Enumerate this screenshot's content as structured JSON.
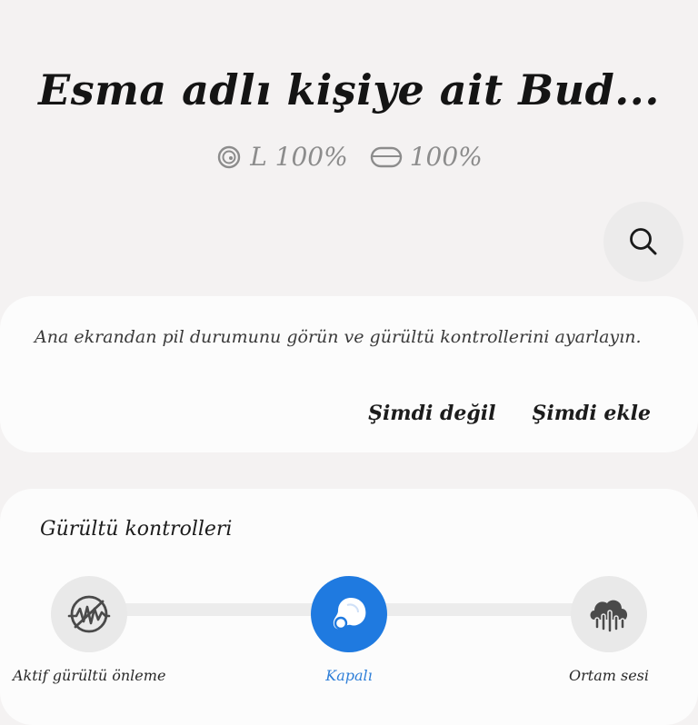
{
  "header": {
    "title": "Esma adlı kişiye ait Bud...",
    "battery": {
      "left_label": "L 100%",
      "case_label": "100%"
    }
  },
  "search": {
    "icon": "search-icon"
  },
  "promo": {
    "message": "Ana ekrandan pil durumunu görün ve gürültü kontrollerini ayarlayın.",
    "not_now_label": "Şimdi değil",
    "add_now_label": "Şimdi ekle"
  },
  "noise_controls": {
    "title": "Gürültü kontrolleri",
    "selected": "Kapalı",
    "accent_color": "#1f7ae0",
    "modes": [
      {
        "label": "Aktif gürültü önleme",
        "icon": "anc-icon",
        "active": false
      },
      {
        "label": "Kapalı",
        "icon": "earbud-icon",
        "active": true
      },
      {
        "label": "Ortam sesi",
        "icon": "ambient-sound-icon",
        "active": false
      }
    ]
  }
}
